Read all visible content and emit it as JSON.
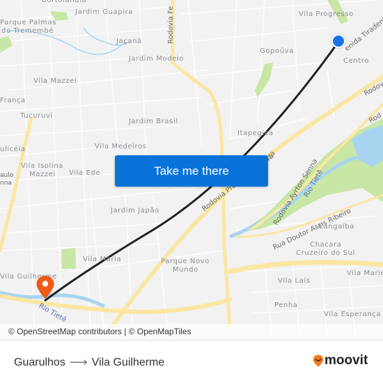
{
  "map": {
    "neighborhoods": [
      {
        "id": "bortolandia",
        "text": "Bortolândia"
      },
      {
        "id": "jardim-guapira",
        "text": "Jardim Guapira"
      },
      {
        "id": "parque-palmas",
        "text": "Parque Palmas"
      },
      {
        "id": "do-tremembe",
        "text": "do Tremembé"
      },
      {
        "id": "jacana",
        "text": "Jaçanã"
      },
      {
        "id": "jardim-modelo",
        "text": "Jardim Modelo"
      },
      {
        "id": "vila-progresso",
        "text": "Vila Progresso"
      },
      {
        "id": "gopouva",
        "text": "Gopoúva"
      },
      {
        "id": "centro",
        "text": "Centro"
      },
      {
        "id": "vila-mazzei",
        "text": "Vila Mazzei"
      },
      {
        "id": "franca",
        "text": "França"
      },
      {
        "id": "tucuruvi",
        "text": "Tucuruvi"
      },
      {
        "id": "jardim-brasil",
        "text": "Jardim Brasil"
      },
      {
        "id": "itapegica",
        "text": "Itapegica"
      },
      {
        "id": "vila-medeiros",
        "text": "Vila Medeiros"
      },
      {
        "id": "ulliceia",
        "text": "ulicéia"
      },
      {
        "id": "vila-isolina",
        "text": "Vila Isolina"
      },
      {
        "id": "mazzei",
        "text": "Mazzei"
      },
      {
        "id": "vila-ede",
        "text": "Vila Ede"
      },
      {
        "id": "aulo",
        "text": "aulo"
      },
      {
        "id": "nna",
        "text": "nna"
      },
      {
        "id": "jardim-japao",
        "text": "Jardim Japão"
      },
      {
        "id": "cangaiba",
        "text": "Cangaíba"
      },
      {
        "id": "chacara",
        "text": "Chacara"
      },
      {
        "id": "cruzeiro-do-sul",
        "text": "Cruzeiro do Sul"
      },
      {
        "id": "vila-maria",
        "text": "Vila Maria"
      },
      {
        "id": "parque-novo",
        "text": "Parque Novo"
      },
      {
        "id": "mundo",
        "text": "Mundo"
      },
      {
        "id": "vila-guilherme",
        "text": "Vila Guilherme"
      },
      {
        "id": "vila-marie",
        "text": "Vila Marie"
      },
      {
        "id": "vila-lais",
        "text": "Vila Laís"
      },
      {
        "id": "penha",
        "text": "Penha"
      },
      {
        "id": "vila-esperanca",
        "text": "Vila Esperança"
      }
    ],
    "roads": {
      "rodovia_fe": "Rodovia Fe",
      "avenida_tiradentes": "enida Tiradentes",
      "rodovia_right1": "Rodov",
      "rodovia_right2": "Rod",
      "rodovia_ayrton_senna": "Rodovia Ayrton Senna",
      "rua_assis_ribeiro": "Rua Doutor Assis Ribeiro",
      "rodovia_dutra": "Rodovia Presidente Dutra",
      "tra": "tra"
    },
    "rivers": {
      "rio_tiete_1": "Rio Tietê",
      "rio_tiete_2": "Rio Tietê"
    },
    "cta_label": "Take me there",
    "attribution": "© OpenStreetMap contributors | © OpenMapTiles",
    "colors": {
      "origin": "#1a73e8",
      "destination": "#f05a16",
      "route_line": "#222222",
      "cta": "#0a73d9",
      "highway": "#fbe7a3",
      "park": "#c8e6a6",
      "water": "#a8d4f0"
    }
  },
  "footer": {
    "origin": "Guarulhos",
    "arrow": "⟶",
    "destination": "Vila Guilherme",
    "brand": "moovit"
  }
}
